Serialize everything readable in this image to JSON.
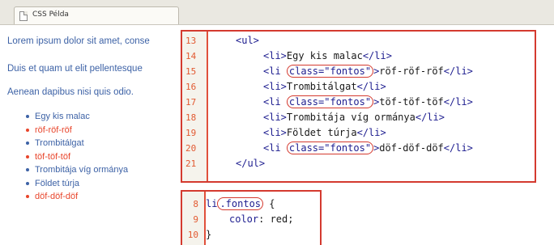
{
  "tab": {
    "title": "CSS Példa",
    "icon": "page-icon"
  },
  "page": {
    "paragraphs": [
      "Lorem ipsum dolor sit amet, conse",
      "Duis et quam ut elit pellentesque",
      "Aenean dapibus nisi quis odio."
    ],
    "list_items": [
      {
        "text": "Egy kis malac",
        "color": "#3d62a6"
      },
      {
        "text": "röf-röf-röf",
        "color": "#e8452b"
      },
      {
        "text": "Trombitálgat",
        "color": "#3d62a6"
      },
      {
        "text": "töf-töf-töf",
        "color": "#e8452b"
      },
      {
        "text": "Trombitája víg ormánya",
        "color": "#3d62a6"
      },
      {
        "text": "Földet túrja",
        "color": "#3d62a6"
      },
      {
        "text": "döf-döf-döf",
        "color": "#e8452b"
      }
    ]
  },
  "html_code": {
    "lines": [
      {
        "num": "13",
        "indent": "  ",
        "open": "<ul>",
        "text": "",
        "close": ""
      },
      {
        "num": "14",
        "indent": "      ",
        "open": "<li>",
        "text": "Egy kis malac",
        "close": "</li>"
      },
      {
        "num": "15",
        "indent": "      ",
        "open": "<li ",
        "attr": "class=\"fontos\"",
        "after": ">",
        "text": "röf-röf-röf",
        "close": "</li>"
      },
      {
        "num": "16",
        "indent": "      ",
        "open": "<li>",
        "text": "Trombitálgat",
        "close": "</li>"
      },
      {
        "num": "17",
        "indent": "      ",
        "open": "<li ",
        "attr": "class=\"fontos\"",
        "after": ">",
        "text": "töf-töf-töf",
        "close": "</li>"
      },
      {
        "num": "18",
        "indent": "      ",
        "open": "<li>",
        "text": "Trombitája víg ormánya",
        "close": "</li>"
      },
      {
        "num": "19",
        "indent": "      ",
        "open": "<li>",
        "text": "Földet túrja",
        "close": "</li>"
      },
      {
        "num": "20",
        "indent": "      ",
        "open": "<li ",
        "attr": "class=\"fontos\"",
        "after": ">",
        "text": "döf-döf-döf",
        "close": "</li>"
      },
      {
        "num": "21",
        "indent": "  ",
        "open": "</ul>",
        "text": "",
        "close": ""
      }
    ]
  },
  "css_code": {
    "lines": [
      {
        "num": "8",
        "selector": "li",
        "ringed": ".fontos",
        "rest": " {"
      },
      {
        "num": "9",
        "property": "color",
        "value": ": red;"
      },
      {
        "num": "10",
        "text": "}"
      }
    ]
  },
  "colors": {
    "highlight_border": "#d43a2f",
    "link_blue": "#3d62a6",
    "list_red": "#e8452b",
    "tag_blue": "#1d1d8f",
    "line_number": "#e25a32"
  }
}
